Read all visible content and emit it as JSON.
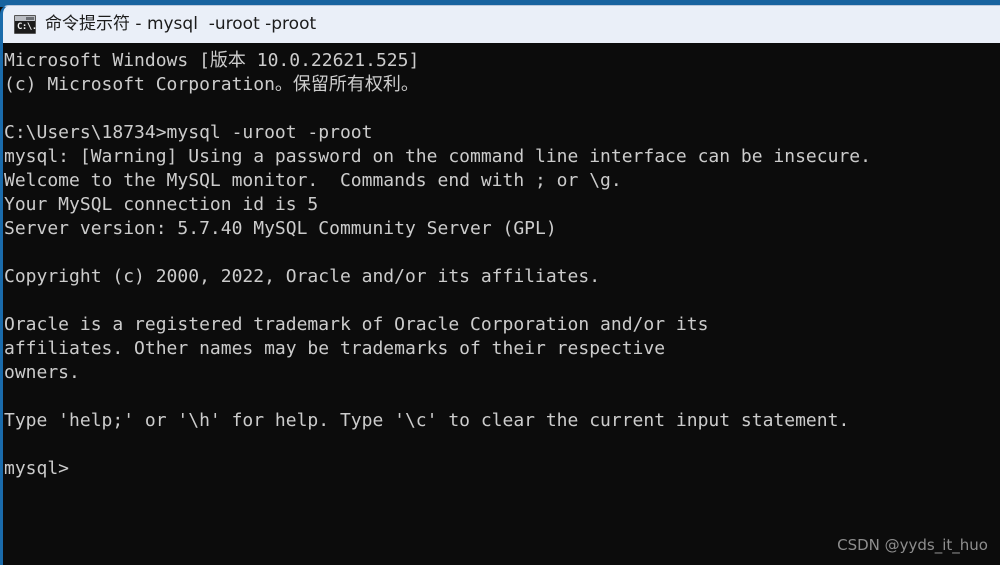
{
  "window": {
    "accent_color": "#18639f",
    "titlebar_bg": "#eaeff8",
    "title": "命令提示符 - mysql  -uroot -proot",
    "icon_name": "cmd-prompt-icon",
    "icon_glyph": "C:\\."
  },
  "console": {
    "bg_color": "#0c0c0c",
    "fg_color": "#cccccc",
    "lines": [
      "Microsoft Windows [版本 10.0.22621.525]",
      "(c) Microsoft Corporation。保留所有权利。",
      "",
      "C:\\Users\\18734>mysql -uroot -proot",
      "mysql: [Warning] Using a password on the command line interface can be insecure.",
      "Welcome to the MySQL monitor.  Commands end with ; or \\g.",
      "Your MySQL connection id is 5",
      "Server version: 5.7.40 MySQL Community Server (GPL)",
      "",
      "Copyright (c) 2000, 2022, Oracle and/or its affiliates.",
      "",
      "Oracle is a registered trademark of Oracle Corporation and/or its",
      "affiliates. Other names may be trademarks of their respective",
      "owners.",
      "",
      "Type 'help;' or '\\h' for help. Type '\\c' to clear the current input statement.",
      "",
      "mysql>"
    ],
    "prompt": "mysql>"
  },
  "watermark": {
    "text": "CSDN @yyds_it_huo",
    "color": "#8e8e8e"
  }
}
